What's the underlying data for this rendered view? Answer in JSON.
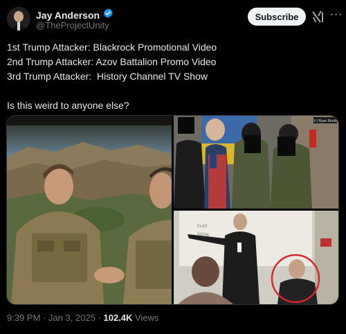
{
  "author": {
    "name": "Jay Anderson",
    "handle": "@TheProjectUnity",
    "verified": true
  },
  "header": {
    "subscribe_label": "Subscribe",
    "more_label": "···"
  },
  "tweet": {
    "lines": [
      "1st Trump Attacker: Blackrock Promotional Video",
      "2nd Trump Attacker: Azov Battalion Promo Video",
      "3rd Trump Attacker:  History Channel TV Show",
      "",
      "Is this weird to anyone else?"
    ]
  },
  "media": {
    "images": [
      {
        "name": "military-promo-still"
      },
      {
        "name": "azov-group-photo",
        "corner_text": "V | Ryan Routh"
      },
      {
        "name": "classroom-tv-still",
        "board_text": [
          "Gold",
          "Siting"
        ]
      }
    ]
  },
  "meta": {
    "time": "9:39 PM",
    "separator": " · ",
    "date": "Jan 3, 2025",
    "views_count": "102.4K",
    "views_label": "Views"
  },
  "colors": {
    "background": "#000000",
    "text": "#e7e9ea",
    "muted": "#71767b",
    "verified": "#1d9bf0",
    "subscribe_bg": "#eff3f4"
  }
}
